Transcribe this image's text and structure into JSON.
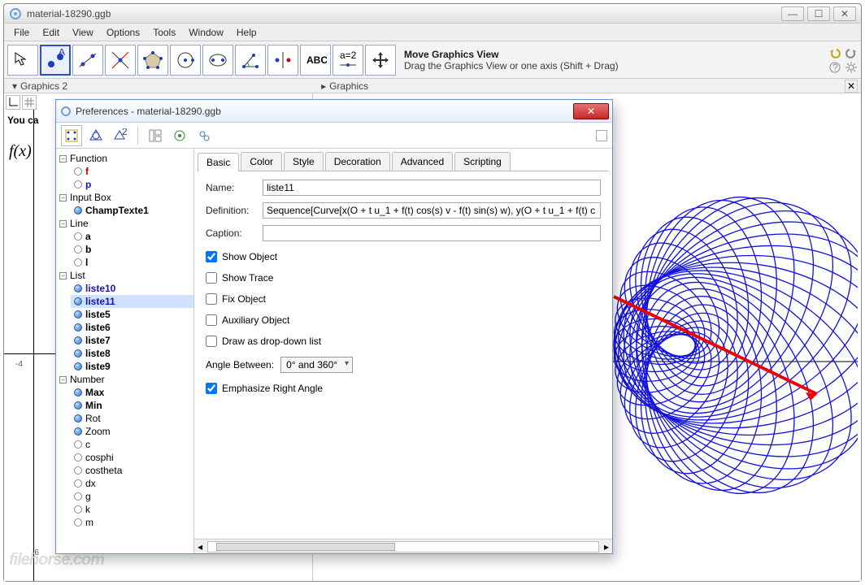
{
  "window": {
    "title": "material-18290.ggb",
    "menus": [
      "File",
      "Edit",
      "View",
      "Options",
      "Tools",
      "Window",
      "Help"
    ]
  },
  "toolbar": {
    "tool_info_title": "Move Graphics View",
    "tool_info_sub": "Drag the Graphics View or one axis (Shift + Drag)"
  },
  "views": {
    "left_tab": "Graphics 2",
    "right_tab": "Graphics",
    "you_can": "You ca",
    "fx": "f(x)",
    "ticks_x": {
      "neg4": "-4",
      "neg6": "-6"
    }
  },
  "dialog": {
    "title": "Preferences - material-18290.ggb",
    "tabs": [
      "Basic",
      "Color",
      "Style",
      "Decoration",
      "Advanced",
      "Scripting"
    ],
    "fields": {
      "name_label": "Name:",
      "name_value": "liste11",
      "def_label": "Definition:",
      "def_value": "Sequence[Curve[x(O + t u_1 + f(t) cos(s) v - f(t) sin(s) w), y(O + t u_1 + f(t) c",
      "caption_label": "Caption:",
      "caption_value": ""
    },
    "checks": {
      "show_object": {
        "label": "Show Object",
        "checked": true
      },
      "show_trace": {
        "label": "Show Trace",
        "checked": false
      },
      "fix_object": {
        "label": "Fix Object",
        "checked": false
      },
      "aux_object": {
        "label": "Auxiliary Object",
        "checked": false
      },
      "dropdown": {
        "label": "Draw as drop-down list",
        "checked": false
      },
      "emph_right": {
        "label": "Emphasize Right Angle",
        "checked": true
      }
    },
    "angle": {
      "label": "Angle Between:",
      "value": "0° and 360°"
    }
  },
  "tree": {
    "groups": [
      {
        "name": "Function",
        "items": [
          {
            "label": "f",
            "cls": "red",
            "filled": false
          },
          {
            "label": "p",
            "cls": "blue",
            "filled": false
          }
        ]
      },
      {
        "name": "Input Box",
        "items": [
          {
            "label": "ChampTexte1",
            "cls": "bold",
            "filled": true
          }
        ]
      },
      {
        "name": "Line",
        "items": [
          {
            "label": "a",
            "cls": "bold",
            "filled": false
          },
          {
            "label": "b",
            "cls": "bold",
            "filled": false
          },
          {
            "label": "l",
            "cls": "bold",
            "filled": false
          }
        ]
      },
      {
        "name": "List",
        "items": [
          {
            "label": "liste10",
            "cls": "blue",
            "filled": true
          },
          {
            "label": "liste11",
            "cls": "blue",
            "filled": true,
            "selected": true
          },
          {
            "label": "liste5",
            "cls": "bold",
            "filled": true
          },
          {
            "label": "liste6",
            "cls": "bold",
            "filled": true
          },
          {
            "label": "liste7",
            "cls": "bold",
            "filled": true
          },
          {
            "label": "liste8",
            "cls": "bold",
            "filled": true
          },
          {
            "label": "liste9",
            "cls": "bold",
            "filled": true
          }
        ]
      },
      {
        "name": "Number",
        "items": [
          {
            "label": "Max",
            "cls": "bold",
            "filled": true
          },
          {
            "label": "Min",
            "cls": "bold",
            "filled": true
          },
          {
            "label": "Rot",
            "cls": "",
            "filled": true
          },
          {
            "label": "Zoom",
            "cls": "",
            "filled": true
          },
          {
            "label": "c",
            "cls": "",
            "filled": false
          },
          {
            "label": "cosphi",
            "cls": "",
            "filled": false
          },
          {
            "label": "costheta",
            "cls": "",
            "filled": false
          },
          {
            "label": "dx",
            "cls": "",
            "filled": false
          },
          {
            "label": "g",
            "cls": "",
            "filled": false
          },
          {
            "label": "k",
            "cls": "",
            "filled": false
          },
          {
            "label": "m",
            "cls": "",
            "filled": false
          }
        ]
      }
    ]
  },
  "watermark": "filehorse.com"
}
